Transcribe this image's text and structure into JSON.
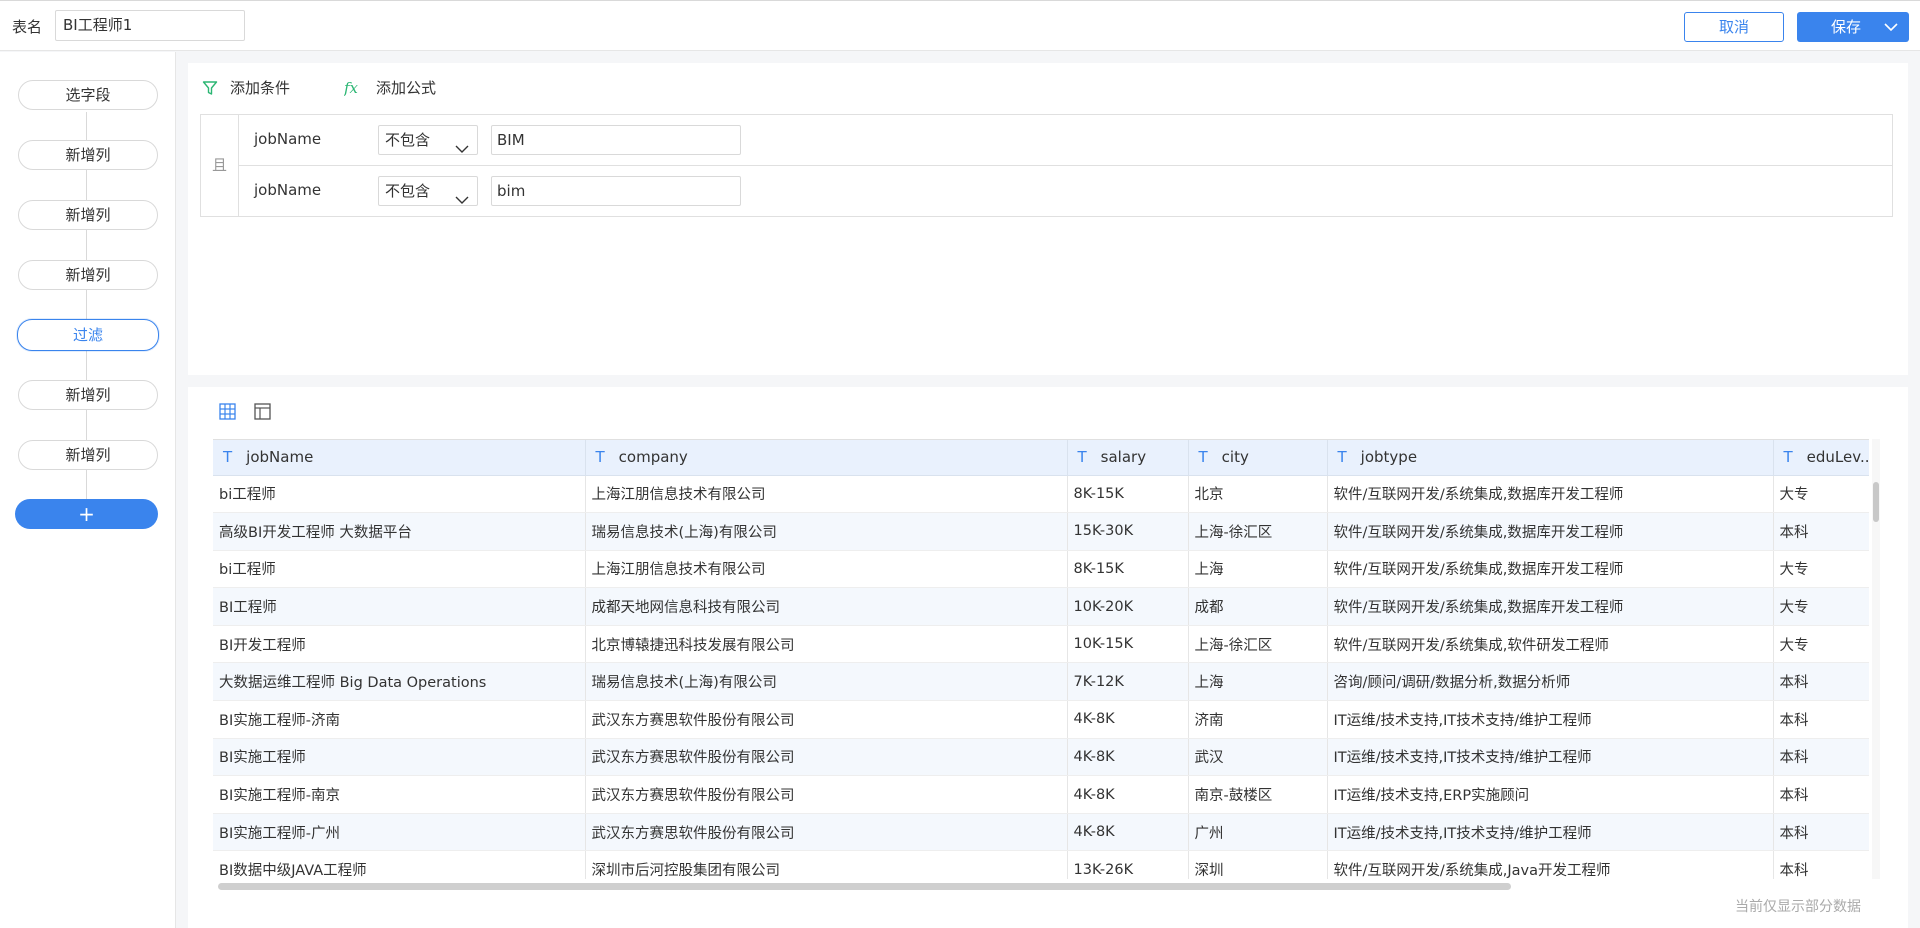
{
  "header": {
    "name_label": "表名",
    "name_value": "BI工程师1",
    "cancel_label": "取消",
    "save_label": "保存"
  },
  "steps": [
    {
      "label": "选字段"
    },
    {
      "label": "新增列"
    },
    {
      "label": "新增列"
    },
    {
      "label": "新增列"
    },
    {
      "label": "过滤",
      "active": true
    },
    {
      "label": "新增列"
    },
    {
      "label": "新增列"
    }
  ],
  "step_add_label": "+",
  "filter": {
    "add_condition": "添加条件",
    "add_formula": "添加公式",
    "logic": "且",
    "conditions": [
      {
        "field": "jobName",
        "operator": "不包含",
        "value": "BIM"
      },
      {
        "field": "jobName",
        "operator": "不包含",
        "value": "bim"
      }
    ]
  },
  "table": {
    "type_marker": "T",
    "columns": [
      "jobName",
      "company",
      "salary",
      "city",
      "jobtype",
      "eduLev..."
    ],
    "rows": [
      [
        "bi工程师",
        "上海江朋信息技术有限公司",
        "8K-15K",
        "北京",
        "软件/互联网开发/系统集成,数据库开发工程师",
        "大专"
      ],
      [
        "高级BI开发工程师 大数据平台",
        "瑞易信息技术(上海)有限公司",
        "15K-30K",
        "上海-徐汇区",
        "软件/互联网开发/系统集成,数据库开发工程师",
        "本科"
      ],
      [
        "bi工程师",
        "上海江朋信息技术有限公司",
        "8K-15K",
        "上海",
        "软件/互联网开发/系统集成,数据库开发工程师",
        "大专"
      ],
      [
        "BI工程师",
        "成都天地网信息科技有限公司",
        "10K-20K",
        "成都",
        "软件/互联网开发/系统集成,数据库开发工程师",
        "大专"
      ],
      [
        "BI开发工程师",
        "北京博辕捷迅科技发展有限公司",
        "10K-15K",
        "上海-徐汇区",
        "软件/互联网开发/系统集成,软件研发工程师",
        "大专"
      ],
      [
        "大数据运维工程师 Big Data Operations",
        "瑞易信息技术(上海)有限公司",
        "7K-12K",
        "上海",
        "咨询/顾问/调研/数据分析,数据分析师",
        "本科"
      ],
      [
        "BI实施工程师-济南",
        "武汉东方赛思软件股份有限公司",
        "4K-8K",
        "济南",
        "IT运维/技术支持,IT技术支持/维护工程师",
        "本科"
      ],
      [
        "BI实施工程师",
        "武汉东方赛思软件股份有限公司",
        "4K-8K",
        "武汉",
        "IT运维/技术支持,IT技术支持/维护工程师",
        "本科"
      ],
      [
        "BI实施工程师-南京",
        "武汉东方赛思软件股份有限公司",
        "4K-8K",
        "南京-鼓楼区",
        "IT运维/技术支持,ERP实施顾问",
        "本科"
      ],
      [
        "BI实施工程师-广州",
        "武汉东方赛思软件股份有限公司",
        "4K-8K",
        "广州",
        "IT运维/技术支持,IT技术支持/维护工程师",
        "本科"
      ],
      [
        "BI数据中级JAVA工程师",
        "深圳市后河控股集团有限公司",
        "13K-26K",
        "深圳",
        "软件/互联网开发/系统集成,Java开发工程师",
        "本科"
      ]
    ]
  },
  "footer_note": "当前仅显示部分数据",
  "colors": {
    "accent": "#3a84ed",
    "filter_icon": "#2bb673"
  }
}
